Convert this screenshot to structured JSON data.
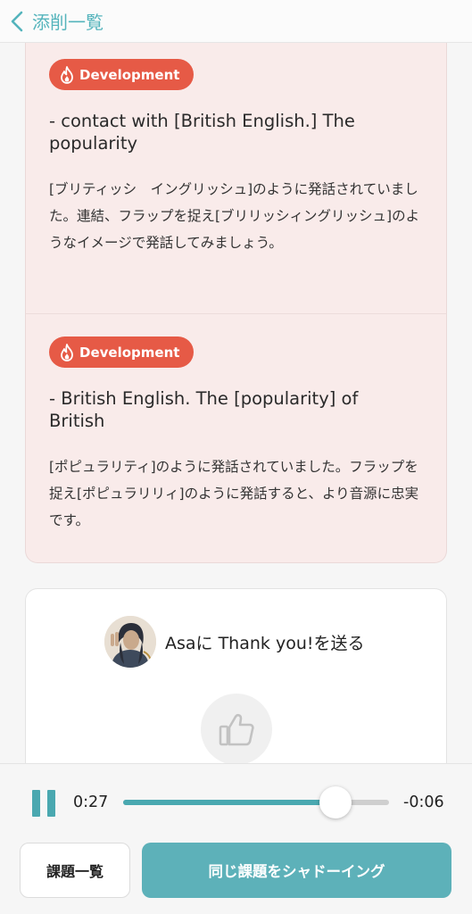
{
  "header": {
    "back_label": "添削一覧"
  },
  "feedback": {
    "items": [
      {
        "badge": "Development",
        "phrase": "- contact with [British English.] The popularity",
        "comment": "[ブリティッシ　イングリッシュ]のように発話されていました。連結、フラップを捉え[ブリリッシィングリッシュ]のようなイメージで発話してみましょう。"
      },
      {
        "badge": "Development",
        "phrase": "- British English. The [popularity] of British",
        "comment": "[ポピュラリティ]のように発話されていました。フラップを捉え[ポピュラリリィ]のように発話すると、より音源に忠実です。"
      }
    ]
  },
  "thanks": {
    "text": "Asaに Thank you!を送る"
  },
  "player": {
    "elapsed": "0:27",
    "remaining": "-0:06",
    "progress": 0.8
  },
  "actions": {
    "list_label": "課題一覧",
    "shadow_label": "同じ課題をシャドーイング"
  },
  "colors": {
    "accent": "#4aa8b0",
    "badge": "#e65a46",
    "card_bg": "#f9ebea"
  }
}
